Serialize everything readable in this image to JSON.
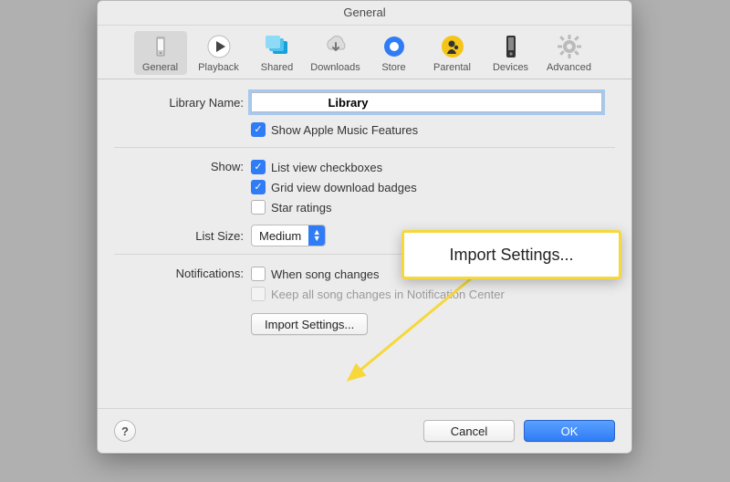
{
  "window": {
    "title": "General"
  },
  "toolbar": {
    "items": [
      {
        "label": "General"
      },
      {
        "label": "Playback"
      },
      {
        "label": "Shared"
      },
      {
        "label": "Downloads"
      },
      {
        "label": "Store"
      },
      {
        "label": "Parental"
      },
      {
        "label": "Devices"
      },
      {
        "label": "Advanced"
      }
    ]
  },
  "labels": {
    "library_name": "Library Name:",
    "show": "Show:",
    "list_size": "List Size:",
    "notifications": "Notifications:"
  },
  "fields": {
    "library_name_value": "                      Library"
  },
  "options": {
    "apple_music": "Show Apple Music Features",
    "list_checkboxes": "List view checkboxes",
    "grid_badges": "Grid view download badges",
    "star_ratings": "Star ratings",
    "song_changes": "When song changes",
    "keep_notifications": "Keep all song changes in Notification Center"
  },
  "list_size_value": "Medium",
  "buttons": {
    "import_settings": "Import Settings...",
    "cancel": "Cancel",
    "ok": "OK",
    "help": "?"
  },
  "callout": {
    "text": "Import Settings..."
  }
}
